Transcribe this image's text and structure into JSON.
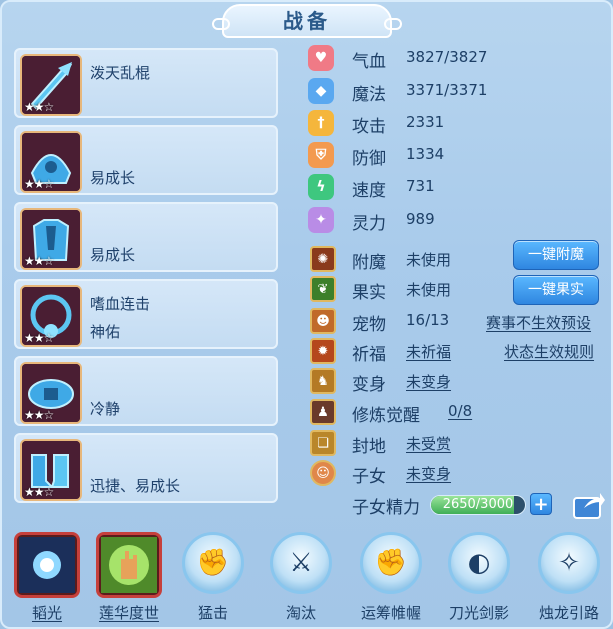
{
  "title": "战备",
  "equipment": [
    {
      "name": "泼天乱棍",
      "attr": "",
      "stars": "★★☆"
    },
    {
      "name": "",
      "attr": "易成长",
      "stars": "★★☆"
    },
    {
      "name": "",
      "attr": "易成长",
      "stars": "★★☆"
    },
    {
      "name": "嗜血连击",
      "attr": "神佑",
      "stars": "★★☆"
    },
    {
      "name": "",
      "attr": "冷静",
      "stars": "★★☆"
    },
    {
      "name": "",
      "attr": "迅捷、易成长",
      "stars": "★★☆"
    }
  ],
  "stats": [
    {
      "label": "气血",
      "value": "3827/3827",
      "icon": "heart-icon",
      "color": "#f07a86"
    },
    {
      "label": "魔法",
      "value": "3371/3371",
      "icon": "mana-icon",
      "color": "#5aa8f0"
    },
    {
      "label": "攻击",
      "value": "2331",
      "icon": "sword-icon",
      "color": "#f5b63c"
    },
    {
      "label": "防御",
      "value": "1334",
      "icon": "shield-icon",
      "color": "#f39a4f"
    },
    {
      "label": "速度",
      "value": "731",
      "icon": "lightning-icon",
      "color": "#3ec77f"
    },
    {
      "label": "灵力",
      "value": "989",
      "icon": "spirit-icon",
      "color": "#b98ce6"
    }
  ],
  "slots": {
    "enchant": {
      "label": "附魔",
      "value": "未使用"
    },
    "fruit": {
      "label": "果实",
      "value": "未使用"
    },
    "pet": {
      "label": "宠物",
      "value": "16/13"
    },
    "blessing": {
      "label": "祈福",
      "value": "未祈福"
    },
    "transform": {
      "label": "变身",
      "value": "未变身"
    },
    "cultivate": {
      "label": "修炼觉醒",
      "value": "0/8"
    },
    "territory": {
      "label": "封地",
      "value": "未受赏"
    },
    "children": {
      "label": "子女",
      "value": "未变身"
    },
    "child_energy": {
      "label": "子女精力",
      "value": "2650/3000",
      "fraction": 0.883
    }
  },
  "buttons": {
    "one_key_enchant": "一键附魔",
    "one_key_fruit": "一键果实",
    "preset_link": "赛事不生效预设",
    "rule_link": "状态生效规则",
    "plus": "+"
  },
  "skills": [
    {
      "label": "韬光",
      "underline": true
    },
    {
      "label": "莲华度世",
      "underline": true
    },
    {
      "label": "猛击",
      "underline": false
    },
    {
      "label": "淘汰",
      "underline": false
    },
    {
      "label": "运筹帷幄",
      "underline": false
    },
    {
      "label": "刀光剑影",
      "underline": false
    },
    {
      "label": "烛龙引路",
      "underline": false
    }
  ]
}
